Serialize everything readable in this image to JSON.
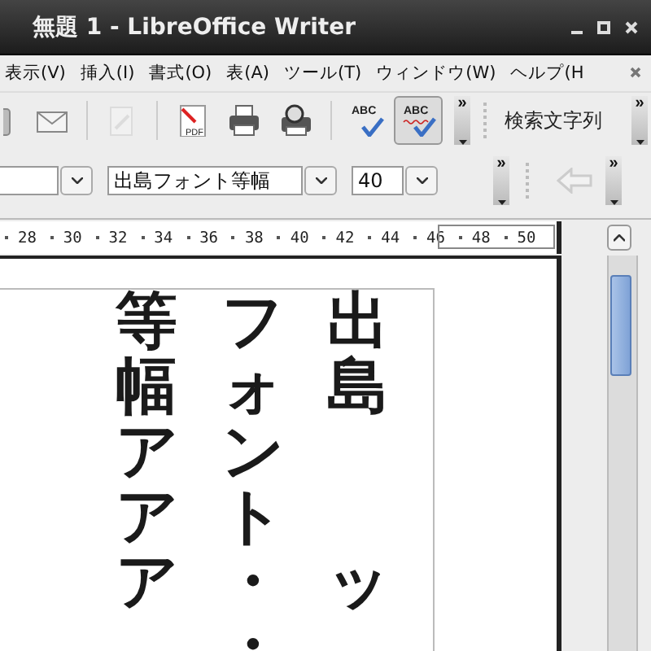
{
  "window": {
    "title": "無題 1 - LibreOffice Writer"
  },
  "menu": [
    {
      "label": "表示(V)"
    },
    {
      "label": "挿入(I)"
    },
    {
      "label": "書式(O)"
    },
    {
      "label": "表(A)"
    },
    {
      "label": "ツール(T)"
    },
    {
      "label": "ウィンドウ(W)"
    },
    {
      "label": "ヘルプ(H"
    }
  ],
  "toolbar": {
    "buttons": [
      {
        "kind": "partial",
        "pressed": false,
        "disabled": false
      },
      {
        "kind": "mail",
        "pressed": false,
        "disabled": false
      },
      {
        "kind": "sep"
      },
      {
        "kind": "edit",
        "pressed": false,
        "disabled": true
      },
      {
        "kind": "sep"
      },
      {
        "kind": "pdf",
        "pressed": false,
        "disabled": false,
        "icon_text": "PDF"
      },
      {
        "kind": "print",
        "pressed": false,
        "disabled": false
      },
      {
        "kind": "preview",
        "pressed": false,
        "disabled": false
      },
      {
        "kind": "sep"
      },
      {
        "kind": "spell",
        "pressed": false,
        "disabled": false,
        "icon_text": "ABC"
      },
      {
        "kind": "autospell",
        "pressed": true,
        "disabled": false,
        "icon_text": "ABC"
      }
    ],
    "overflow": "»",
    "search_placeholder": "検索文字列",
    "search_overflow": "»"
  },
  "format_bar": {
    "font_name": "出島フォント等幅",
    "font_size": "40",
    "overflow": "»",
    "back_disabled": true,
    "end_overflow": "»"
  },
  "ruler": {
    "numbers": [
      "28",
      "30",
      "32",
      "34",
      "36",
      "38",
      "40",
      "42",
      "44",
      "46",
      "48",
      "50"
    ]
  },
  "document": {
    "columns": [
      {
        "segments": [
          "等幅アアア"
        ]
      },
      {
        "segments": [
          "フォント・・"
        ]
      },
      {
        "segments": [
          "出島",
          "ッ"
        ]
      }
    ]
  }
}
